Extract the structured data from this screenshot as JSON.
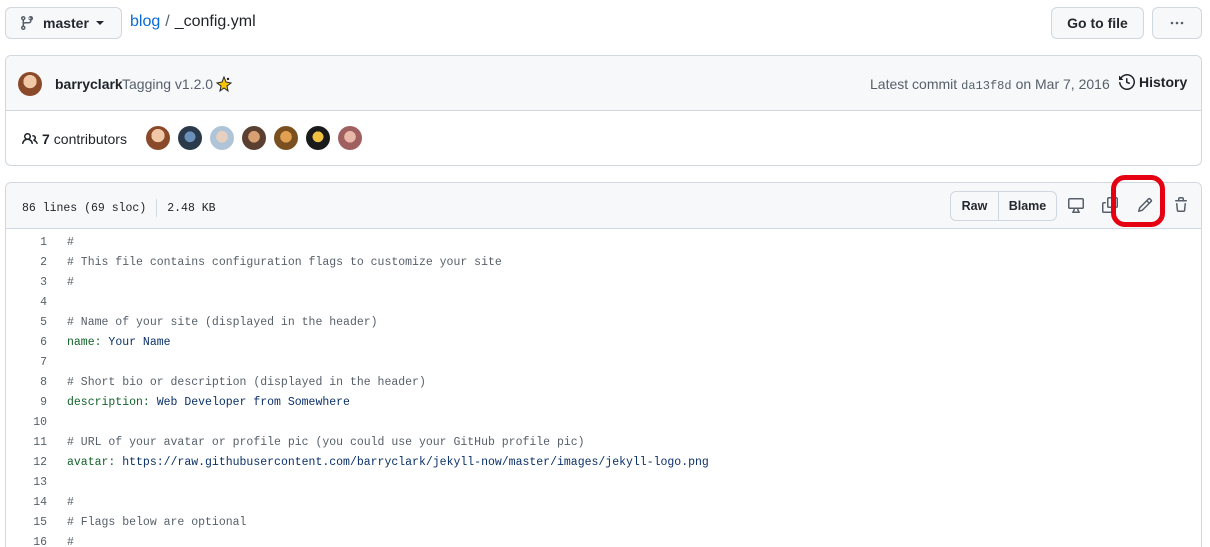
{
  "branch": {
    "name": "master"
  },
  "breadcrumb": {
    "repo": "blog",
    "separator": "/",
    "file": "_config.yml"
  },
  "actions": {
    "go_to_file": "Go to file",
    "more": "···"
  },
  "commit": {
    "author": "barryclark",
    "message": "Tagging v1.2.0",
    "latest_label": "Latest commit",
    "sha": "da13f8d",
    "date": "on Mar 7, 2016",
    "history": "History"
  },
  "contributors": {
    "count": "7",
    "label": "contributors"
  },
  "file": {
    "lines_info": "86 lines (69 sloc)",
    "size": "2.48 KB",
    "raw": "Raw",
    "blame": "Blame"
  },
  "code_lines": [
    {
      "n": "1",
      "text": "#",
      "kind": "comment"
    },
    {
      "n": "2",
      "text": "# This file contains configuration flags to customize your site",
      "kind": "comment"
    },
    {
      "n": "3",
      "text": "#",
      "kind": "comment"
    },
    {
      "n": "4",
      "text": "",
      "kind": "blank"
    },
    {
      "n": "5",
      "text": "# Name of your site (displayed in the header)",
      "kind": "comment"
    },
    {
      "n": "6",
      "key": "name:",
      "value": " Your Name",
      "kind": "kv"
    },
    {
      "n": "7",
      "text": "",
      "kind": "blank"
    },
    {
      "n": "8",
      "text": "# Short bio or description (displayed in the header)",
      "kind": "comment"
    },
    {
      "n": "9",
      "key": "description:",
      "value": " Web Developer from Somewhere",
      "kind": "kv"
    },
    {
      "n": "10",
      "text": "",
      "kind": "blank"
    },
    {
      "n": "11",
      "text": "# URL of your avatar or profile pic (you could use your GitHub profile pic)",
      "kind": "comment"
    },
    {
      "n": "12",
      "key": "avatar:",
      "value": " https://raw.githubusercontent.com/barryclark/jekyll-now/master/images/jekyll-logo.png",
      "kind": "kv"
    },
    {
      "n": "13",
      "text": "",
      "kind": "blank"
    },
    {
      "n": "14",
      "text": "#",
      "kind": "comment"
    },
    {
      "n": "15",
      "text": "# Flags below are optional",
      "kind": "comment"
    },
    {
      "n": "16",
      "text": "#",
      "kind": "comment"
    }
  ],
  "icons": {
    "branch": "git-branch-icon",
    "history": "history-icon",
    "contributors": "people-icon",
    "display": "desktop-icon",
    "copy": "copy-icon",
    "edit": "pencil-icon",
    "delete": "trash-icon"
  },
  "colors": {
    "link": "#0969da",
    "highlight": "#e50012",
    "yaml_key": "#116329",
    "yaml_value": "#0a3069"
  }
}
